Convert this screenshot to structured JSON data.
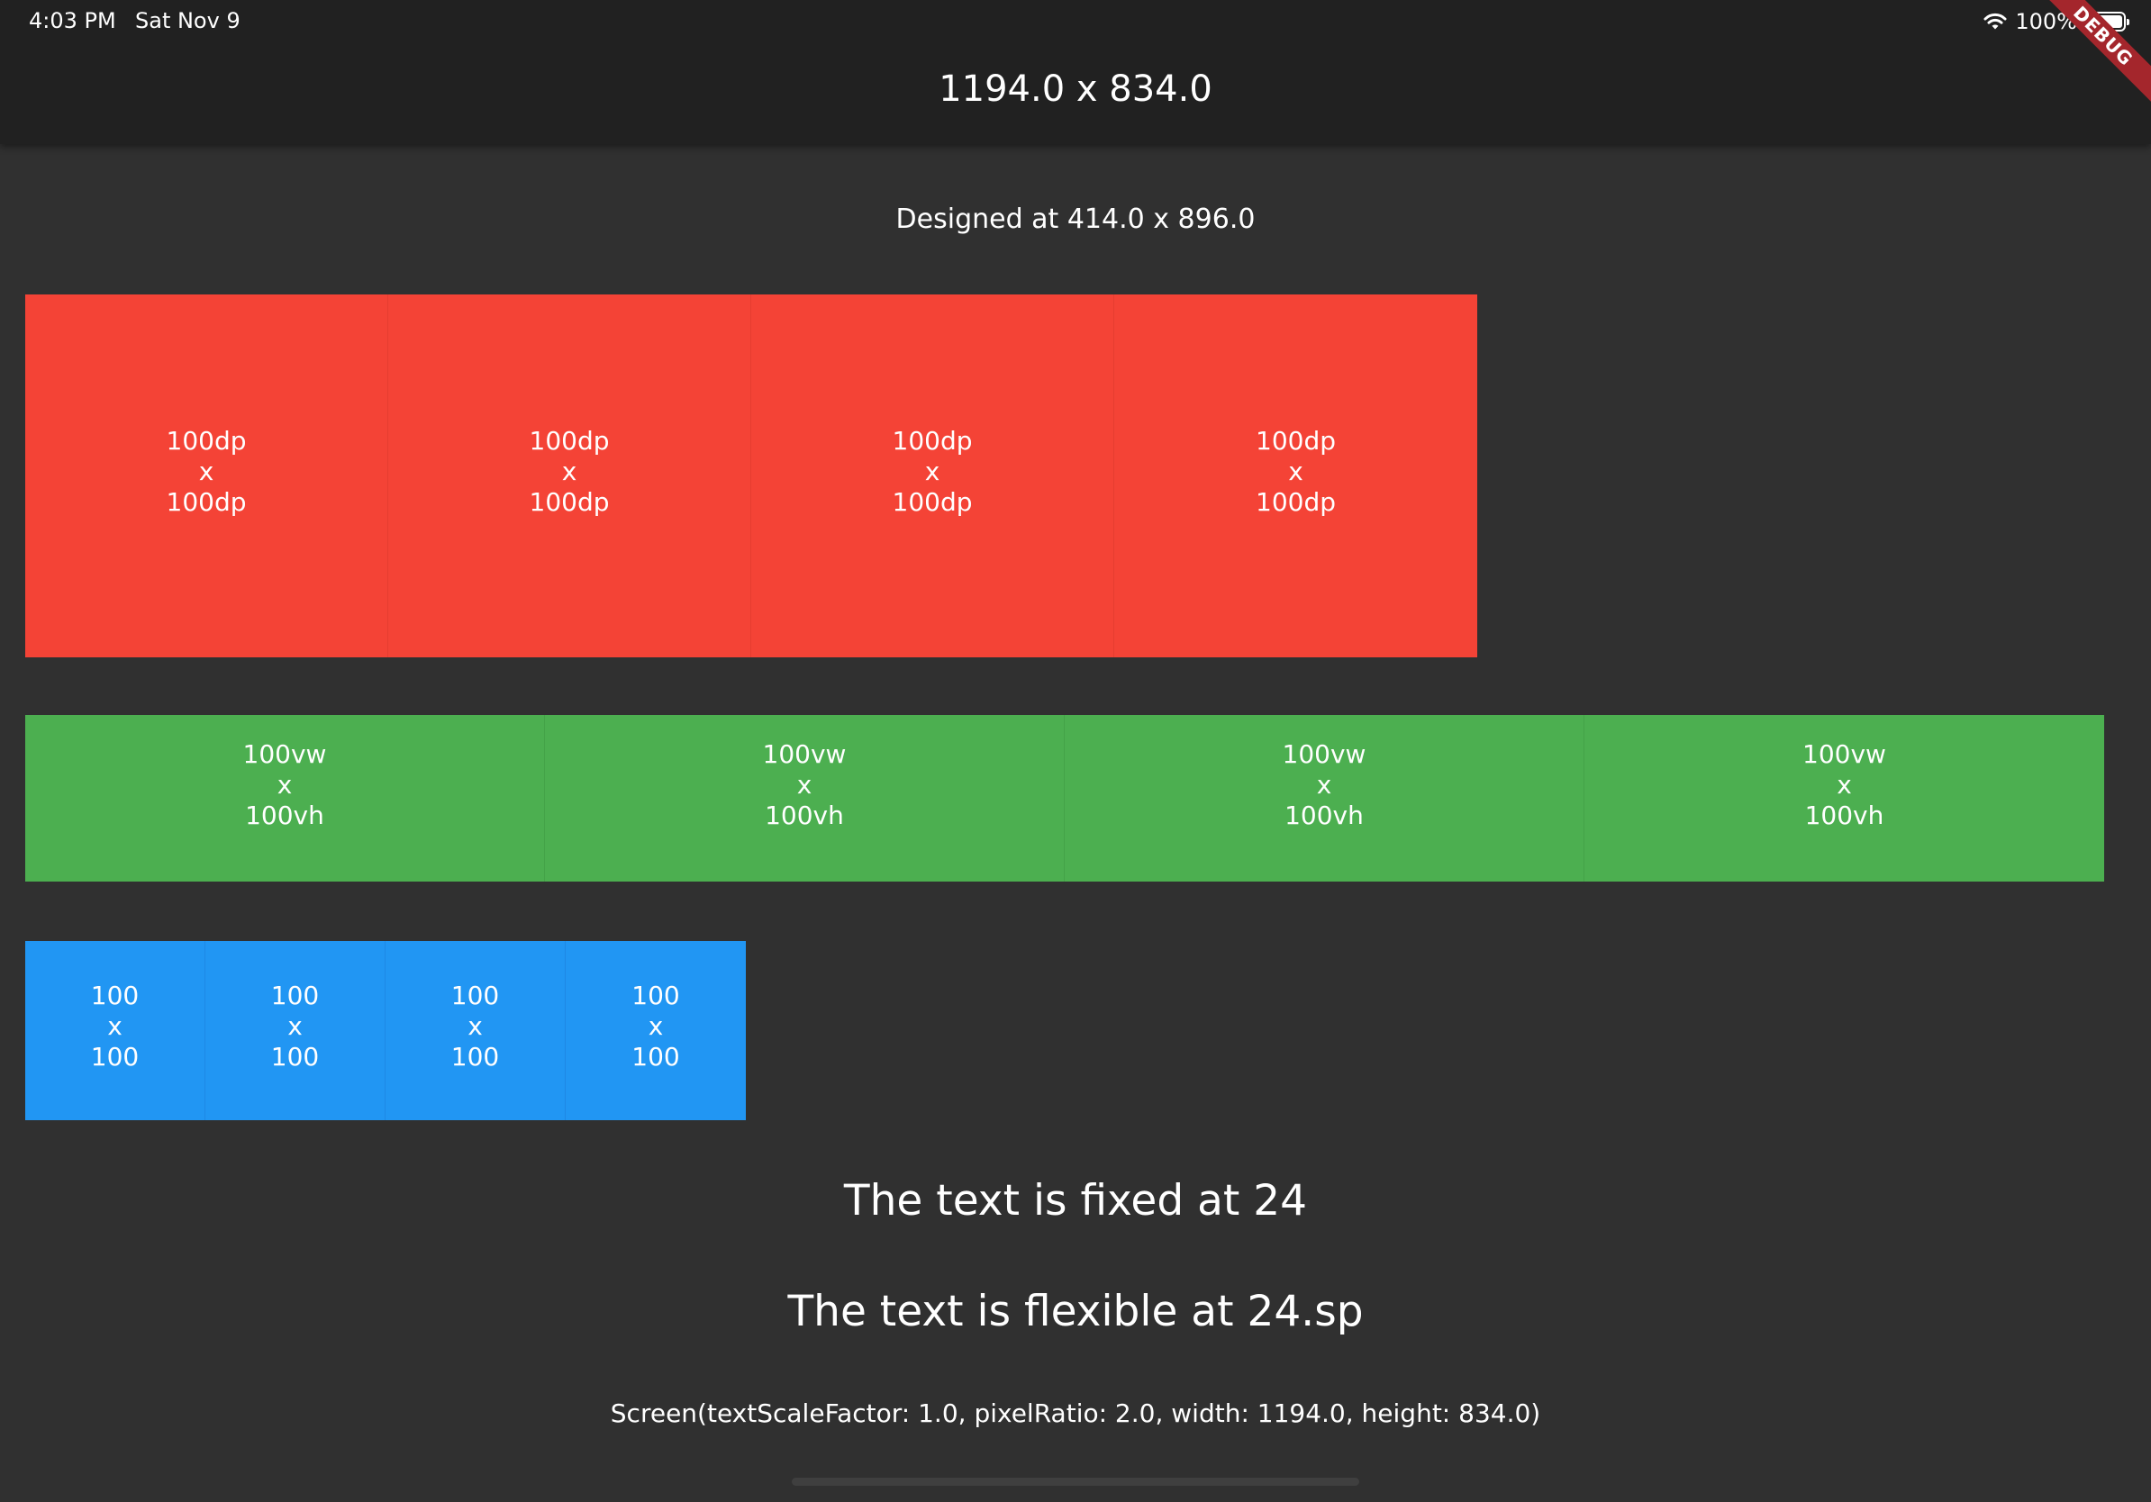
{
  "status_bar": {
    "time": "4:03 PM",
    "date": "Sat Nov 9",
    "battery": "100%"
  },
  "app_bar": {
    "title": "1194.0 x 834.0"
  },
  "debug_banner": "DEBUG",
  "designed_at": "Designed at 414.0 x 896.0",
  "red_boxes": [
    {
      "w": "100dp",
      "x": "x",
      "h": "100dp"
    },
    {
      "w": "100dp",
      "x": "x",
      "h": "100dp"
    },
    {
      "w": "100dp",
      "x": "x",
      "h": "100dp"
    },
    {
      "w": "100dp",
      "x": "x",
      "h": "100dp"
    }
  ],
  "green_boxes": [
    {
      "w": "100vw",
      "x": "x",
      "h": "100vh"
    },
    {
      "w": "100vw",
      "x": "x",
      "h": "100vh"
    },
    {
      "w": "100vw",
      "x": "x",
      "h": "100vh"
    },
    {
      "w": "100vw",
      "x": "x",
      "h": "100vh"
    }
  ],
  "blue_boxes": [
    {
      "w": "100",
      "x": "x",
      "h": "100"
    },
    {
      "w": "100",
      "x": "x",
      "h": "100"
    },
    {
      "w": "100",
      "x": "x",
      "h": "100"
    },
    {
      "w": "100",
      "x": "x",
      "h": "100"
    }
  ],
  "fixed_text": "The text is fixed at 24",
  "flexible_text": "The text is flexible at 24.sp",
  "screen_info": "Screen(textScaleFactor: 1.0, pixelRatio: 2.0, width: 1194.0, height: 834.0)",
  "colors": {
    "background": "#303030",
    "app_bar": "#212121",
    "red": "#f44336",
    "green": "#4caf50",
    "blue": "#2196f3",
    "debug_banner": "#a4262c"
  }
}
